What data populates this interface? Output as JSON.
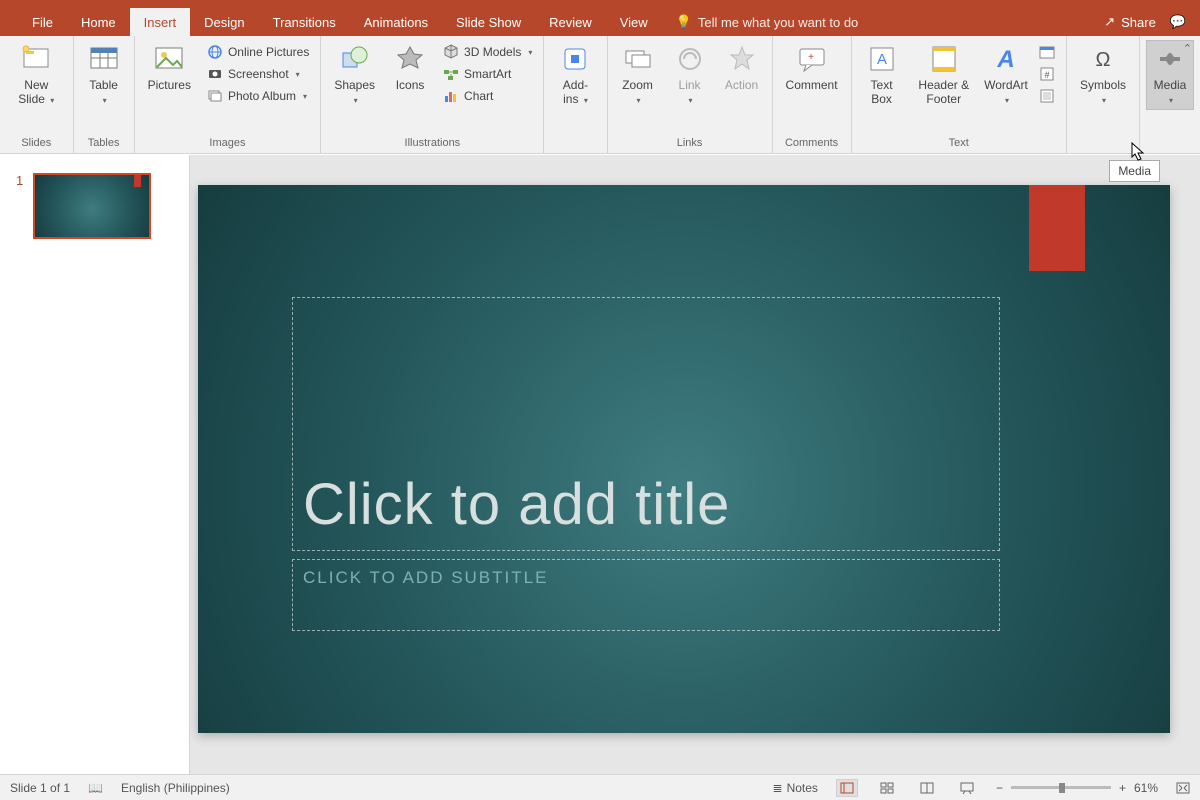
{
  "tabs": [
    "File",
    "Home",
    "Insert",
    "Design",
    "Transitions",
    "Animations",
    "Slide Show",
    "Review",
    "View"
  ],
  "active_tab": "Insert",
  "tellme": "Tell me what you want to do",
  "share": "Share",
  "ribbon": {
    "slides": {
      "new_slide": "New Slide",
      "label": "Slides"
    },
    "tables": {
      "table": "Table",
      "label": "Tables"
    },
    "images": {
      "pictures": "Pictures",
      "online": "Online Pictures",
      "screenshot": "Screenshot",
      "album": "Photo Album",
      "label": "Images"
    },
    "illustrations": {
      "shapes": "Shapes",
      "icons": "Icons",
      "models": "3D Models",
      "smartart": "SmartArt",
      "chart": "Chart",
      "label": "Illustrations"
    },
    "addins": {
      "addins": "Add-ins",
      "label": ""
    },
    "links": {
      "zoom": "Zoom",
      "link": "Link",
      "action": "Action",
      "label": "Links"
    },
    "comments": {
      "comment": "Comment",
      "label": "Comments"
    },
    "text": {
      "textbox": "Text Box",
      "hf": "Header & Footer",
      "wordart": "WordArt",
      "label": "Text"
    },
    "symbols": {
      "symbols": "Symbols"
    },
    "media": {
      "media": "Media"
    }
  },
  "tooltip": "Media",
  "slide": {
    "number": "1",
    "title_placeholder": "Click to add title",
    "subtitle_placeholder": "CLICK TO ADD SUBTITLE"
  },
  "status": {
    "slide": "Slide 1 of 1",
    "lang": "English (Philippines)",
    "notes": "Notes",
    "zoom": "61%"
  }
}
